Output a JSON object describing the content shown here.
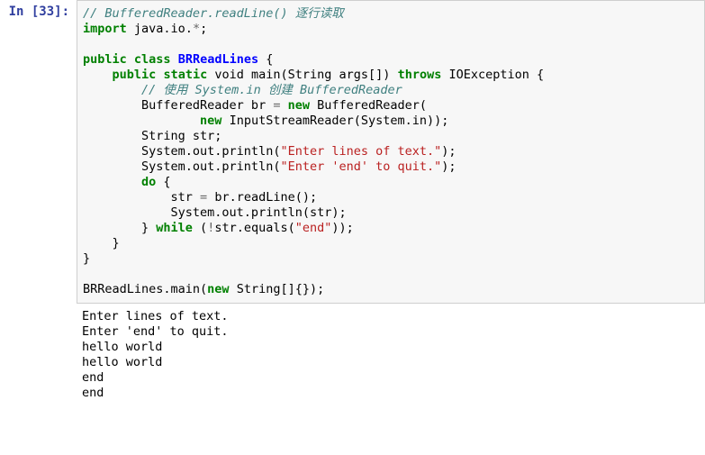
{
  "prompt": {
    "label": "In [33]:"
  },
  "code": {
    "line1_comment": "// BufferedReader.readLine() 逐行读取",
    "import_kw": "import",
    "import_pkg": " java.io.",
    "import_star": "*",
    "semicolon": ";",
    "public_kw": "public",
    "class_kw": "class",
    "class_name": "BRReadLines",
    "static_kw": "static",
    "void_kw": " void ",
    "main_name": "main",
    "main_params": "(String args[]) ",
    "throws_kw": "throws",
    "throws_type": " IOException {",
    "inner_comment": "// 使用 System.in 创建 BufferedReader",
    "br_decl1": "        BufferedReader br ",
    "eq_op": "=",
    "new_kw": "new",
    "br_decl2": " BufferedReader(",
    "isr_line": " InputStreamReader(System.in));",
    "str_decl": "        String str;",
    "sout1a": "        System.out.println(",
    "sout1_str": "\"Enter lines of text.\"",
    "sout1b": ");",
    "sout2a": "        System.out.println(",
    "sout2_str": "\"Enter 'end' to quit.\"",
    "sout2b": ");",
    "do_kw": "do",
    "brace_open": " {",
    "readline": "            str ",
    "readline_b": " br.readLine();",
    "sout3": "            System.out.println(str);",
    "close_brace": "        } ",
    "while_kw": "while",
    "while_cond_a": " (",
    "not_op": "!",
    "while_cond_b": "str.equals(",
    "end_str": "\"end\"",
    "while_cond_c": "));",
    "method_close": "    }",
    "class_close": "}",
    "call_line_a": "BRReadLines.main(",
    "call_line_b": " String[]{});"
  },
  "output": {
    "line1": "Enter lines of text.",
    "line2": "Enter 'end' to quit.",
    "line3": "hello world",
    "line4": "hello world",
    "line5": "end",
    "line6": "end"
  }
}
